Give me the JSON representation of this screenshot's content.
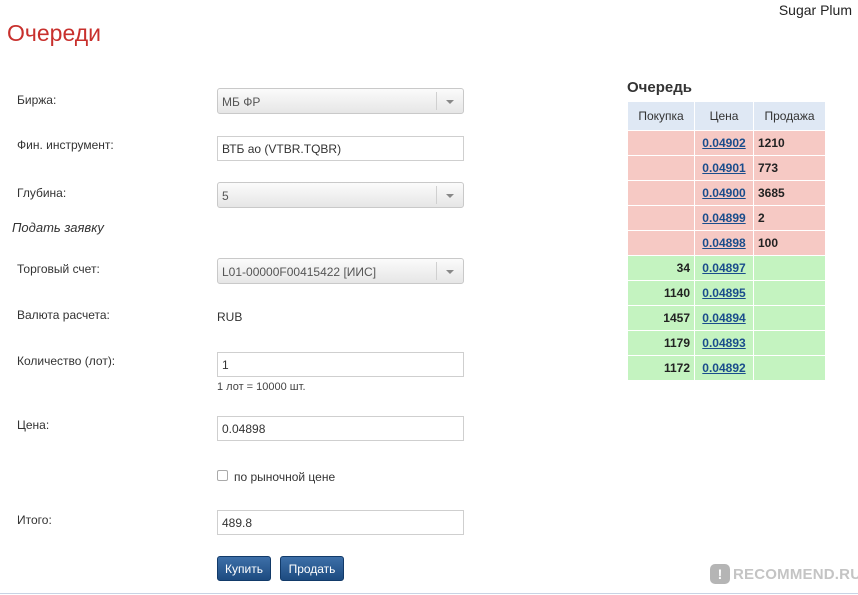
{
  "header": {
    "user_name": "Sugar Plum",
    "page_title": "Очереди"
  },
  "form": {
    "exchange_label": "Биржа:",
    "exchange_value": "МБ ФР",
    "instrument_label": "Фин. инструмент:",
    "instrument_value": "ВТБ ао (VTBR.TQBR)",
    "depth_label": "Глубина:",
    "depth_value": "5",
    "order_section_title": "Подать заявку",
    "account_label": "Торговый счет:",
    "account_value": "L01-00000F00415422 [ИИС]",
    "currency_label": "Валюта расчета:",
    "currency_value": "RUB",
    "quantity_label": "Количество (лот):",
    "quantity_value": "1",
    "lot_hint": "1 лот = 10000 шт.",
    "price_label": "Цена:",
    "price_value": "0.04898",
    "market_price_label": "по рыночной цене",
    "market_price_checked": false,
    "total_label": "Итого:",
    "total_value": "489.8",
    "buy_button": "Купить",
    "sell_button": "Продать"
  },
  "order_book": {
    "title": "Очередь",
    "columns": {
      "buy": "Покупка",
      "price": "Цена",
      "sell": "Продажа"
    },
    "sell_rows": [
      {
        "buy": "",
        "price": "0.04902",
        "sell": "1210"
      },
      {
        "buy": "",
        "price": "0.04901",
        "sell": "773"
      },
      {
        "buy": "",
        "price": "0.04900",
        "sell": "3685"
      },
      {
        "buy": "",
        "price": "0.04899",
        "sell": "2"
      },
      {
        "buy": "",
        "price": "0.04898",
        "sell": "100"
      }
    ],
    "buy_rows": [
      {
        "buy": "34",
        "price": "0.04897",
        "sell": ""
      },
      {
        "buy": "1140",
        "price": "0.04895",
        "sell": ""
      },
      {
        "buy": "1457",
        "price": "0.04894",
        "sell": ""
      },
      {
        "buy": "1179",
        "price": "0.04893",
        "sell": ""
      },
      {
        "buy": "1172",
        "price": "0.04892",
        "sell": ""
      }
    ],
    "colors": {
      "sell_bg": "#f6c9c4",
      "buy_bg": "#c4f3c0",
      "header_bg": "#dfe8f4"
    }
  },
  "watermark": {
    "icon": "recommend-logo-icon",
    "text": "RECOMMEND.RU"
  }
}
